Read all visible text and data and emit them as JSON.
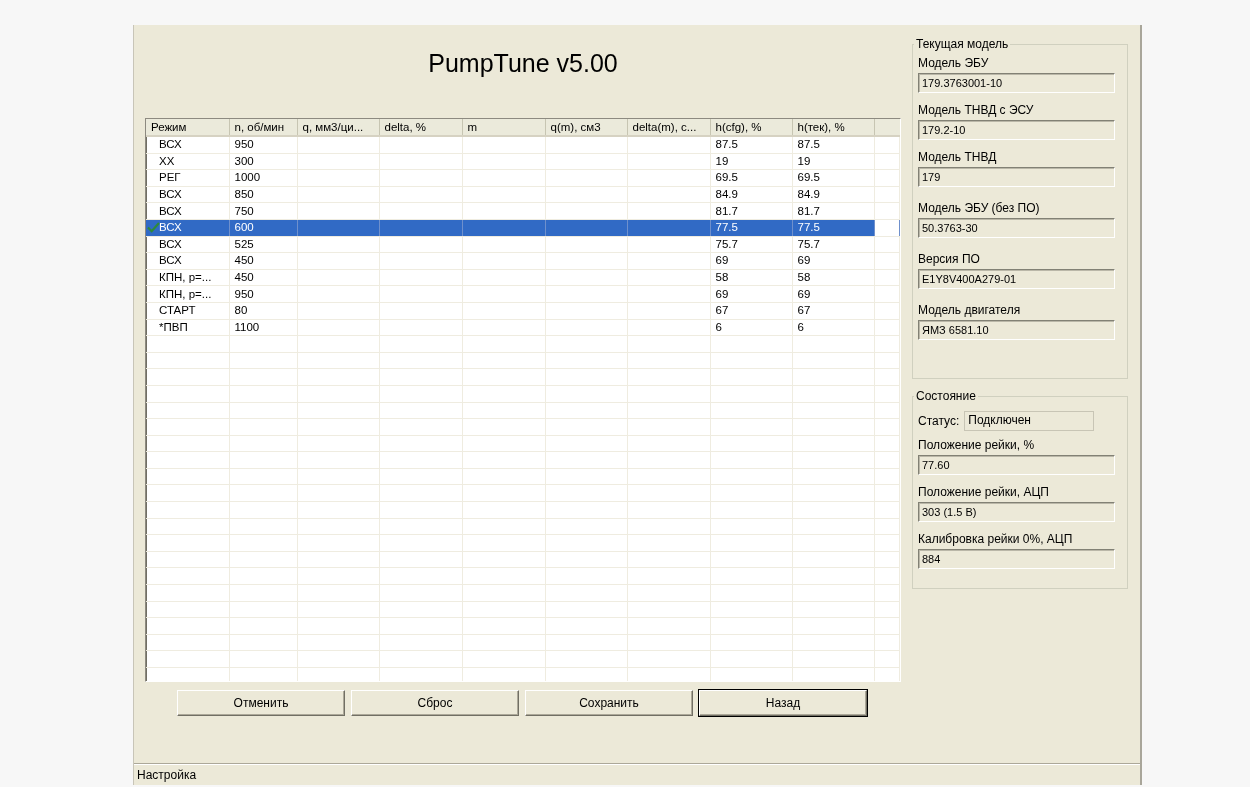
{
  "title": "PumpTune v5.00",
  "table": {
    "columns": [
      "Режим",
      "n, об/мин",
      "q, мм3/ци...",
      "delta, %",
      "m",
      "q(m), см3",
      "delta(m), с...",
      "h(cfg), %",
      "h(тек), %"
    ],
    "rows": [
      {
        "cells": [
          "ВСХ",
          "950",
          "",
          "",
          "",
          "",
          "",
          "87.5",
          "87.5"
        ],
        "selected": false
      },
      {
        "cells": [
          "ХХ",
          "300",
          "",
          "",
          "",
          "",
          "",
          "19",
          "19"
        ],
        "selected": false
      },
      {
        "cells": [
          "РЕГ",
          "1000",
          "",
          "",
          "",
          "",
          "",
          "69.5",
          "69.5"
        ],
        "selected": false
      },
      {
        "cells": [
          "ВСХ",
          "850",
          "",
          "",
          "",
          "",
          "",
          "84.9",
          "84.9"
        ],
        "selected": false
      },
      {
        "cells": [
          "ВСХ",
          "750",
          "",
          "",
          "",
          "",
          "",
          "81.7",
          "81.7"
        ],
        "selected": false
      },
      {
        "cells": [
          "ВСХ",
          "600",
          "",
          "",
          "",
          "",
          "",
          "77.5",
          "77.5"
        ],
        "selected": true
      },
      {
        "cells": [
          "ВСХ",
          "525",
          "",
          "",
          "",
          "",
          "",
          "75.7",
          "75.7"
        ],
        "selected": false
      },
      {
        "cells": [
          "ВСХ",
          "450",
          "",
          "",
          "",
          "",
          "",
          "69",
          "69"
        ],
        "selected": false
      },
      {
        "cells": [
          "КПН, р=...",
          "450",
          "",
          "",
          "",
          "",
          "",
          "58",
          "58"
        ],
        "selected": false
      },
      {
        "cells": [
          "КПН, р=...",
          "950",
          "",
          "",
          "",
          "",
          "",
          "69",
          "69"
        ],
        "selected": false
      },
      {
        "cells": [
          "СТАРТ",
          "80",
          "",
          "",
          "",
          "",
          "",
          "67",
          "67"
        ],
        "selected": false
      },
      {
        "cells": [
          "*ПВП",
          "1100",
          "",
          "",
          "",
          "",
          "",
          "6",
          "6"
        ],
        "selected": false
      }
    ]
  },
  "buttons": [
    {
      "label": "Отменить",
      "default": false
    },
    {
      "label": "Сброс",
      "default": false
    },
    {
      "label": "Сохранить",
      "default": false
    },
    {
      "label": "Назад",
      "default": true
    }
  ],
  "current_model": {
    "title": "Текущая модель",
    "fields": [
      {
        "label": "Модель ЭБУ",
        "value": "179.3763001-10"
      },
      {
        "label": "Модель ТНВД с ЭСУ",
        "value": "179.2-10"
      },
      {
        "label": "Модель ТНВД",
        "value": "179"
      },
      {
        "label": "Модель ЭБУ (без ПО)",
        "value": "50.3763-30"
      },
      {
        "label": "Версия ПО",
        "value": "E1Y8V400A279-01"
      },
      {
        "label": "Модель двигателя",
        "value": "ЯМЗ 6581.10"
      }
    ]
  },
  "state": {
    "title": "Состояние",
    "status_label": "Статус:",
    "status_value": "Подключен",
    "fields": [
      {
        "label": "Положение рейки, %",
        "value": "77.60"
      },
      {
        "label": "Положение рейки, АЦП",
        "value": "303 (1.5 В)"
      },
      {
        "label": "Калибровка рейки 0%, АЦП",
        "value": "884"
      }
    ]
  },
  "status_bar": "Настройка"
}
